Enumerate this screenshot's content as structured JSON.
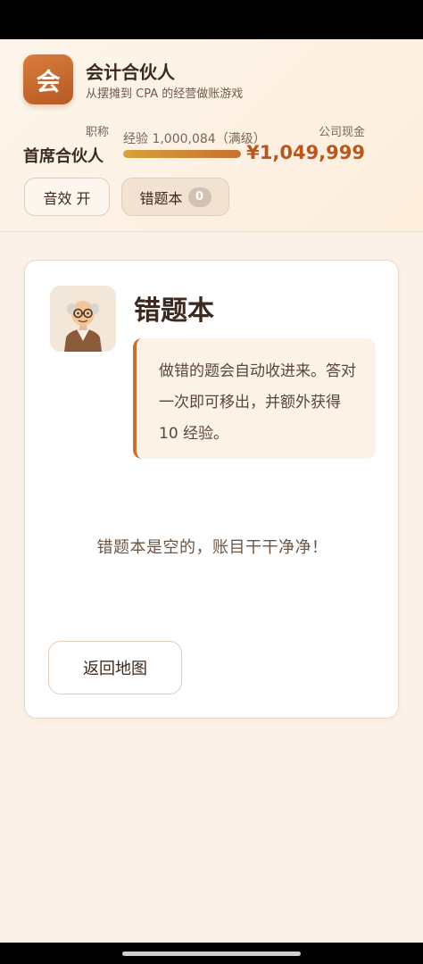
{
  "app": {
    "logo_char": "会",
    "title": "会计合伙人",
    "subtitle": "从摆摊到 CPA 的经营做账游戏"
  },
  "stats": {
    "title_label": "职称",
    "title_value": "首席合伙人",
    "xp_label": "经验 1,000,084（满级）",
    "xp_progress_percent": 100,
    "cash_label": "公司现金",
    "cash_value": "¥1,049,999"
  },
  "header_buttons": {
    "sound_label": "音效 开",
    "mistakes_label": "错题本",
    "mistakes_count": "0"
  },
  "card": {
    "title": "错题本",
    "speech": "做错的题会自动收进来。答对一次即可移出，并额外获得 10 经验。",
    "empty_message": "错题本是空的，账目干干净净！",
    "back_button": "返回地图"
  },
  "colors": {
    "accent": "#c8702e",
    "cash": "#b7581f",
    "background": "#fbf1e8"
  },
  "icons": {
    "avatar": "old-accountant-avatar-icon"
  }
}
